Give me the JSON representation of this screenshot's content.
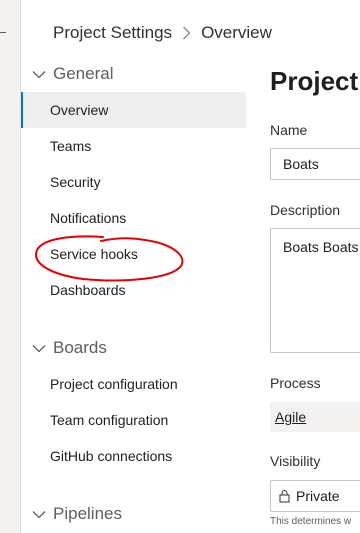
{
  "breadcrumb": {
    "root": "Project Settings",
    "current": "Overview"
  },
  "nav": {
    "general": {
      "header": "General",
      "items": [
        "Overview",
        "Teams",
        "Security",
        "Notifications",
        "Service hooks",
        "Dashboards"
      ],
      "selected": "Overview"
    },
    "boards": {
      "header": "Boards",
      "items": [
        "Project configuration",
        "Team configuration",
        "GitHub connections"
      ]
    },
    "pipelines": {
      "header": "Pipelines"
    }
  },
  "content": {
    "title": "Project",
    "name_label": "Name",
    "name_value": "Boats",
    "description_label": "Description",
    "description_value": "Boats Boats",
    "process_label": "Process",
    "process_value": "Agile",
    "visibility_label": "Visibility",
    "visibility_value": "Private",
    "visibility_hint": "This determines w"
  },
  "colors": {
    "accent": "#0078d4",
    "annotation": "#e60000",
    "selected_bg": "#efefef"
  },
  "icons": [
    "chevron-right-icon",
    "chevron-down-icon",
    "lock-icon"
  ]
}
